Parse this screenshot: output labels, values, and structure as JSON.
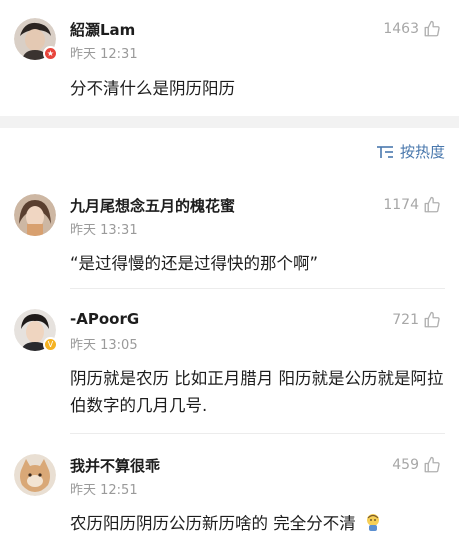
{
  "top_comment": {
    "username": "紹灝Lam",
    "time": "昨天 12:31",
    "likes": "1463",
    "text": "分不清什么是阴历阳历"
  },
  "sort": {
    "label": "按热度"
  },
  "replies": [
    {
      "username": "九月尾想念五月的槐花蜜",
      "time": "昨天 13:31",
      "likes": "1174",
      "text": "“是过得慢的还是过得快的那个啊”"
    },
    {
      "username": "-APoorG",
      "time": "昨天 13:05",
      "likes": "721",
      "text": "阴历就是农历 比如正月腊月 阳历就是公历就是阿拉伯数字的几月几号."
    },
    {
      "username": "我并不算很乖",
      "time": "昨天 12:51",
      "likes": "459",
      "text": "农历阳历阴历公历新历啥的 完全分不清"
    }
  ],
  "colors": {
    "accent": "#4a78ad",
    "muted": "#9a9a9a",
    "red_badge": "#e8453c",
    "gold_badge": "#f5b323"
  }
}
